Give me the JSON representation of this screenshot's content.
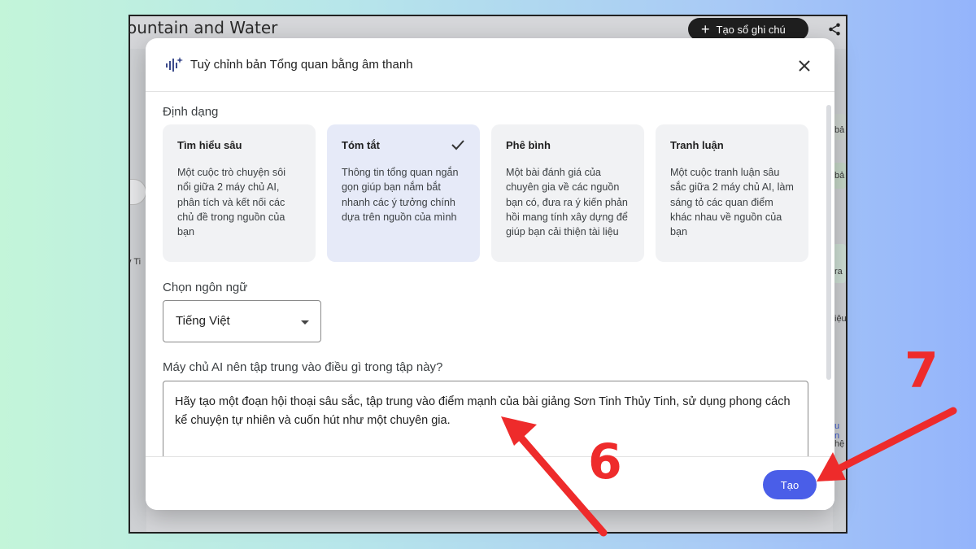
{
  "background_app": {
    "title_fragment": "ountain and Water",
    "new_note_label": "Tạo sổ ghi chú",
    "left_fragment": "y Ti",
    "right_fragments": [
      "bả",
      "bả",
      "ra",
      "iệu",
      "u n",
      "hệ"
    ]
  },
  "dialog": {
    "title": "Tuỳ chỉnh bản Tổng quan bằng âm thanh",
    "format_label": "Định dạng",
    "formats": [
      {
        "title": "Tìm hiểu sâu",
        "description": "Một cuộc trò chuyện sôi nổi giữa 2 máy chủ AI, phân tích và kết nối các chủ đề trong nguồn của bạn",
        "selected": false
      },
      {
        "title": "Tóm tắt",
        "description": "Thông tin tổng quan ngắn gọn giúp bạn nắm bắt nhanh các ý tưởng chính dựa trên nguồn của mình",
        "selected": true
      },
      {
        "title": "Phê bình",
        "description": "Một bài đánh giá của chuyên gia về các nguồn bạn có, đưa ra ý kiến phản hồi mang tính xây dựng để giúp bạn cải thiện tài liệu",
        "selected": false
      },
      {
        "title": "Tranh luận",
        "description": "Một cuộc tranh luận sâu sắc giữa 2 máy chủ AI, làm sáng tỏ các quan điểm khác nhau về nguồn của bạn",
        "selected": false
      }
    ],
    "language_label": "Chọn ngôn ngữ",
    "language_value": "Tiếng Việt",
    "focus_label": "Máy chủ AI nên tập trung vào điều gì trong tập này?",
    "focus_value": "Hãy tạo một đoạn hội thoại sâu sắc, tập trung vào điểm mạnh của bài giảng Sơn Tinh Thủy Tinh, sử dụng phong cách kể chuyện tự nhiên và cuốn hút như một chuyên gia.",
    "create_label": "Tạo"
  },
  "annotations": {
    "step_a": "6",
    "step_b": "7",
    "color": "#ee2b2b"
  },
  "colors": {
    "primary_button": "#4a5ee8",
    "selected_card": "#e6eaf8"
  },
  "icons": [
    "audio-sparkle-icon",
    "close-icon",
    "check-icon",
    "caret-down-icon",
    "share-icon",
    "plus-icon"
  ]
}
